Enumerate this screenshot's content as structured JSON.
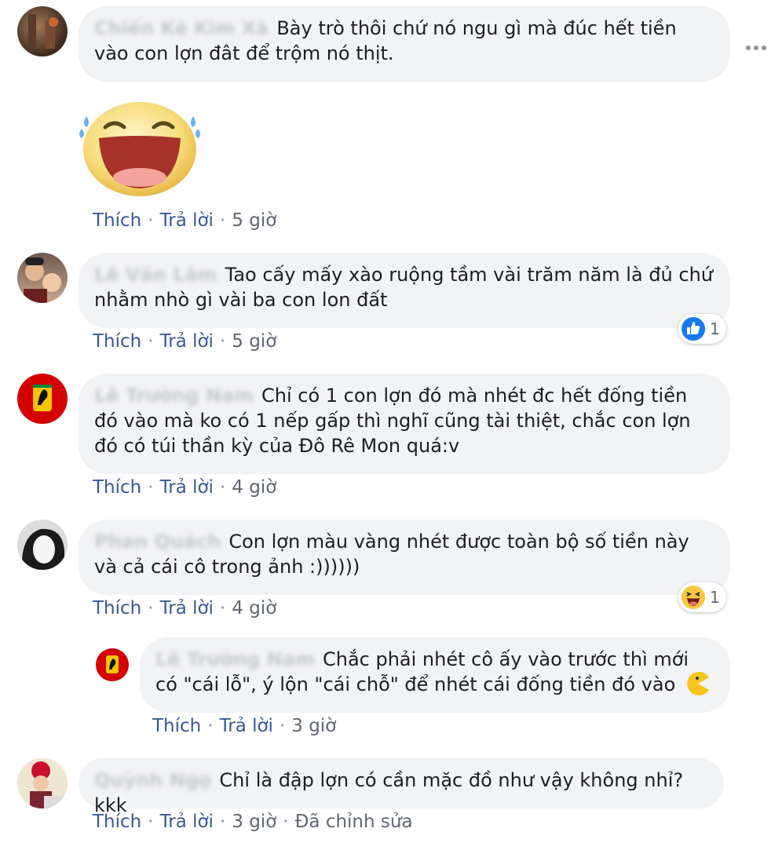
{
  "comments": [
    {
      "author": "Chiến Kè Kim Xà",
      "text": "Bày trò thôi chứ nó ngu gì mà đúc hết tiền vào con lợn đât để trộm nó thịt.",
      "like": "Thích",
      "reply": "Trả lời",
      "time": "5 giờ"
    },
    {
      "author": "Lê Văn Lâm",
      "text": "Tao cấy mấy xào ruộng tầm vài trăm năm là đủ chứ nhằm nhò gì vài ba con lon đất",
      "like": "Thích",
      "reply": "Trả lời",
      "time": "5 giờ",
      "reaction_count": "1"
    },
    {
      "author": "Lê Trường Nam",
      "text": "Chỉ có 1 con lợn đó mà nhét đc hết đống tiền đó vào mà ko có 1 nếp gấp thì nghĩ cũng tài thiệt, chắc con lợn đó có túi thần kỳ của Đô Rê Mon quá:v",
      "like": "Thích",
      "reply": "Trả lời",
      "time": "4 giờ"
    },
    {
      "author": "Phan Quách",
      "text": "Con lợn màu vàng nhét được toàn bộ số tiền này và cả cái cô trong ảnh :))))))",
      "like": "Thích",
      "reply": "Trả lời",
      "time": "4 giờ",
      "reaction_count": "1"
    },
    {
      "author": "Lê Trường Nam",
      "text": "Chắc phải nhét cô ấy vào trước thì mới có \"cái lỗ\", ý lộn \"cái chỗ\" để nhét cái đống tiền đó vào",
      "like": "Thích",
      "reply": "Trả lời",
      "time": "3 giờ"
    },
    {
      "author": "Quỳnh Ngọ",
      "text": "Chỉ là đập lợn có cần mặc đồ như vậy không nhỉ? kkk",
      "like": "Thích",
      "reply": "Trả lời",
      "time": "3 giờ",
      "edited": "Đã chỉnh sửa"
    }
  ],
  "colors": {
    "link": "#385898",
    "bubble": "#f2f3f5",
    "meta": "#606770",
    "like_blue": "#1877f2"
  }
}
